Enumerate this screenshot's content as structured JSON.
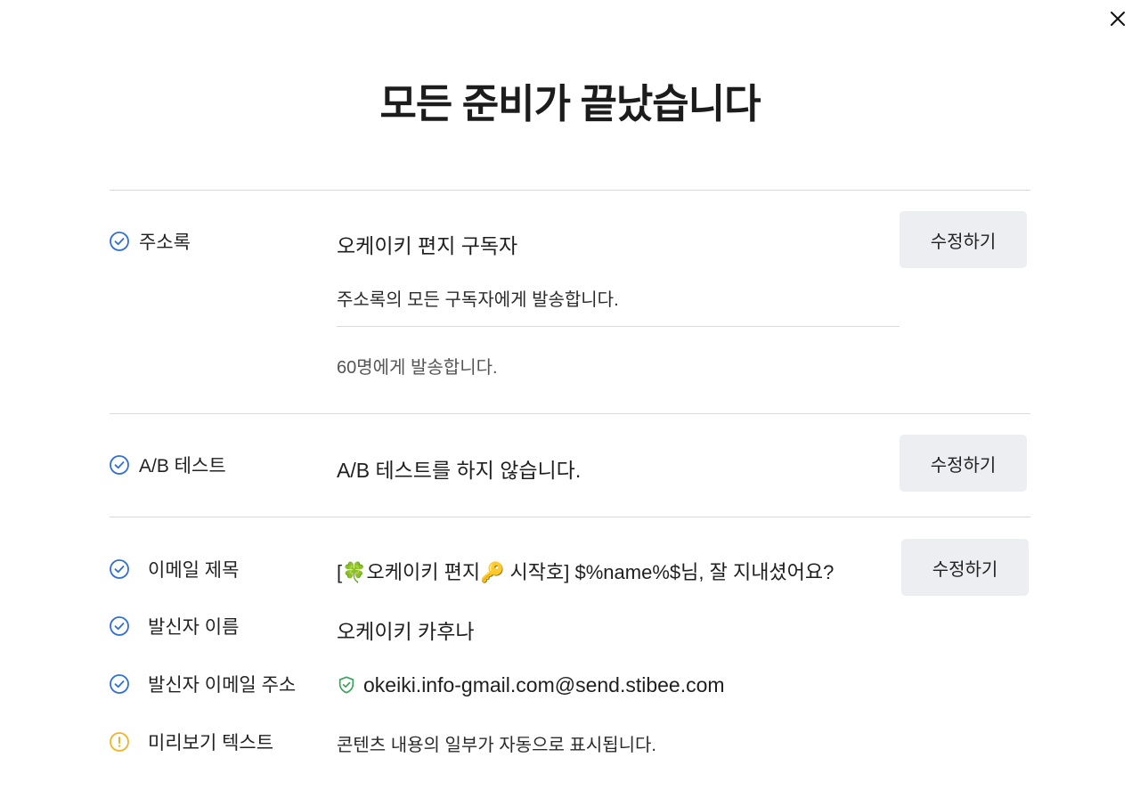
{
  "dialog": {
    "title": "모든 준비가 끝났습니다",
    "close_label": "close"
  },
  "sections": {
    "address_book": {
      "label": "주소록",
      "status": "ok",
      "value": "오케이키 편지 구독자",
      "description": "주소록의 모든 구독자에게 발송합니다.",
      "count_text": "60명에게 발송합니다.",
      "edit_label": "수정하기"
    },
    "ab_test": {
      "label": "A/B 테스트",
      "status": "ok",
      "value": "A/B 테스트를 하지 않습니다.",
      "edit_label": "수정하기"
    },
    "email": {
      "edit_label": "수정하기",
      "subject": {
        "label": "이메일 제목",
        "status": "ok",
        "value": "[🍀오케이키 편지🔑 시작호] $%name%$님, 잘 지내셨어요?"
      },
      "sender_name": {
        "label": "발신자 이름",
        "status": "ok",
        "value": "오케이키 카후나"
      },
      "sender_email": {
        "label": "발신자 이메일 주소",
        "status": "ok",
        "value": "okeiki.info-gmail.com@send.stibee.com",
        "verified_icon": "shield-check-icon"
      },
      "preview_text": {
        "label": "미리보기 텍스트",
        "status": "warning",
        "value": "콘텐츠 내용의 일부가 자동으로 표시됩니다."
      }
    }
  },
  "colors": {
    "check_blue": "#2f6fd6",
    "warning_yellow": "#f0b429",
    "shield_green": "#3aa15a",
    "button_bg": "#eceef2",
    "divider": "#d9d9de"
  },
  "icons": {
    "close": "close-icon",
    "check": "check-circle-icon",
    "warning": "warning-circle-icon"
  }
}
